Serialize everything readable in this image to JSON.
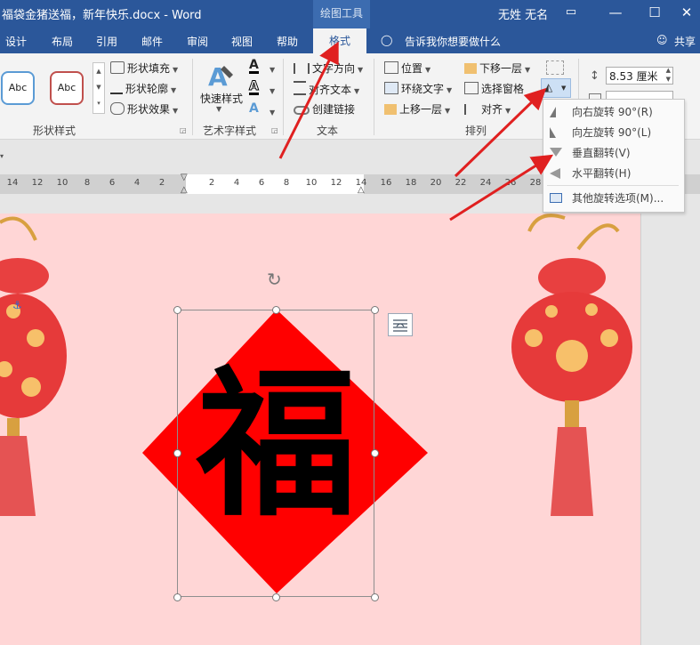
{
  "window": {
    "title": "福袋金猪送福，新年快乐.docx  -  Word",
    "context_group": "绘图工具",
    "user": "无姓 无名",
    "controls": [
      "▭",
      "—",
      "☐",
      "✕"
    ]
  },
  "tabs": [
    {
      "label": "设计"
    },
    {
      "label": "布局"
    },
    {
      "label": "引用"
    },
    {
      "label": "邮件"
    },
    {
      "label": "审阅"
    },
    {
      "label": "视图"
    },
    {
      "label": "帮助"
    },
    {
      "label": "格式"
    }
  ],
  "tellme": "告诉我你想要做什么",
  "share": "共享",
  "ribbon": {
    "shape_styles": {
      "label": "形状样式",
      "gallery": [
        "Abc",
        "Abc"
      ],
      "fill": "形状填充",
      "outline": "形状轮廓",
      "effects": "形状效果"
    },
    "wordart": {
      "label": "艺术字样式",
      "quick_styles": "快速样式"
    },
    "text": {
      "label": "文本",
      "direction": "文字方向",
      "align": "对齐文本",
      "link": "创建链接"
    },
    "arrange": {
      "label": "排列",
      "position": "位置",
      "wrap": "环绕文字",
      "forward": "上移一层",
      "backward": "下移一层",
      "selection_pane": "选择窗格",
      "align": "对齐"
    },
    "size": {
      "height": "8.53 厘米"
    }
  },
  "rotate_menu": [
    {
      "label": "向右旋转 90°(R)",
      "icon": "rotate-right-icon"
    },
    {
      "label": "向左旋转 90°(L)",
      "icon": "rotate-left-icon"
    },
    {
      "label": "垂直翻转(V)",
      "icon": "flip-vertical-icon"
    },
    {
      "label": "水平翻转(H)",
      "icon": "flip-horizontal-icon"
    },
    {
      "label": "其他旋转选项(M)...",
      "icon": "more-rotation-icon"
    }
  ],
  "ruler": [
    "14",
    "12",
    "10",
    "8",
    "6",
    "4",
    "2",
    "",
    "2",
    "4",
    "6",
    "8",
    "10",
    "12",
    "14",
    "16",
    "18",
    "20",
    "22",
    "24",
    "26",
    "28"
  ],
  "document": {
    "fu_character": "福"
  },
  "colors": {
    "title_blue": "#2b579a",
    "page_pink": "#ffd6d6",
    "diamond_red": "#ff0000",
    "arrow_red": "#e02020"
  }
}
